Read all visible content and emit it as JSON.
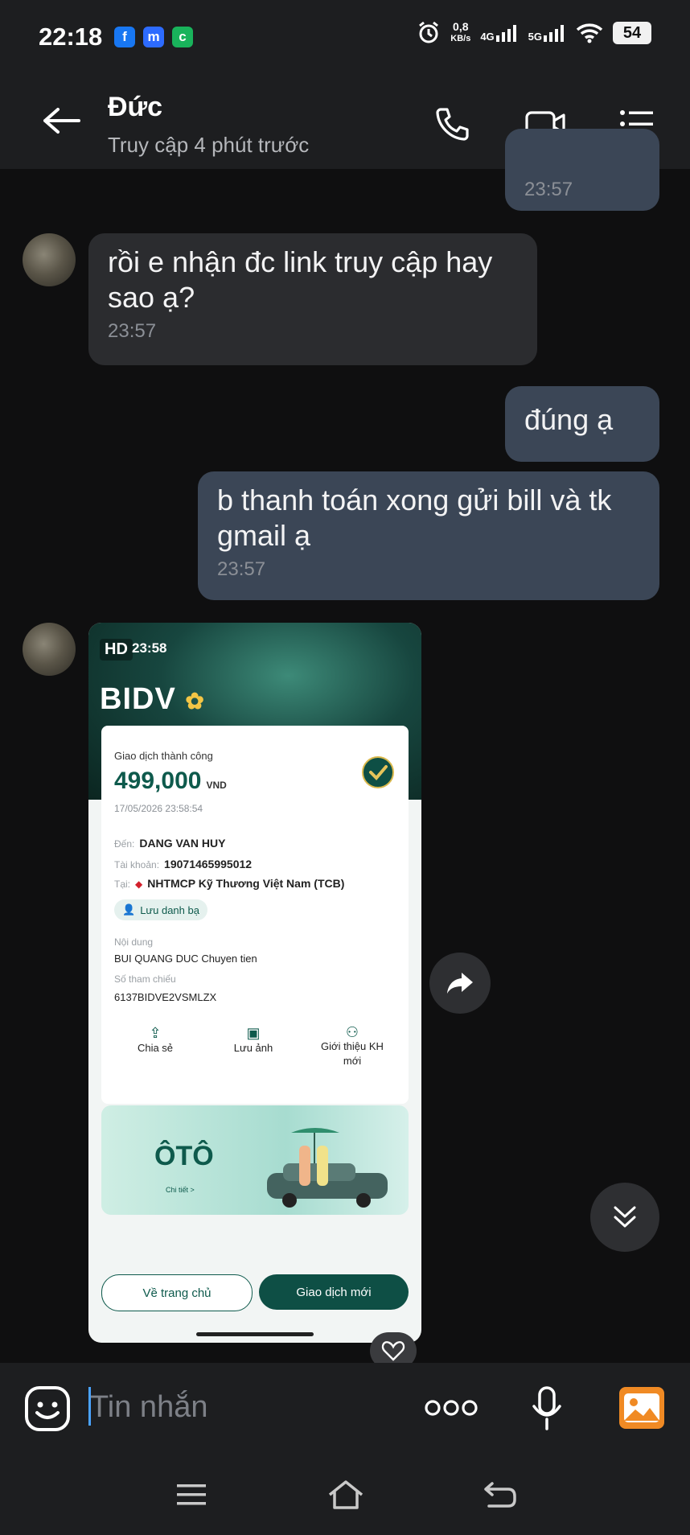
{
  "status_bar": {
    "time": "22:18",
    "apps": [
      "f",
      "m",
      "c"
    ],
    "speed_value": "0,8",
    "speed_unit": "KB/s",
    "net1": "4G",
    "net2": "5G",
    "battery": "54"
  },
  "header": {
    "name": "Đức",
    "subtitle": "Truy cập 4 phút trước"
  },
  "messages": {
    "m0_time": "23:57",
    "m1_text": "rồi e nhận đc link truy cập hay sao ạ?",
    "m1_time": "23:57",
    "m2_text": "đúng ạ",
    "m3_text": "b thanh toán xong gửi bill và tk gmail ạ",
    "m3_time": "23:57"
  },
  "receipt": {
    "hd_label": "HD",
    "status_time": "23:58",
    "bank_logo": "BIDV",
    "status_title": "Giao dịch thành công",
    "amount": "499,000",
    "currency": "VND",
    "datetime": "17/05/2026 23:58:54",
    "to_label": "Đến:",
    "to_value": "DANG VAN HUY",
    "account_label": "Tài khoản:",
    "account_value": "19071465995012",
    "at_label": "Tại:",
    "bank_value": "NHTMCP Kỹ Thương Việt Nam (TCB)",
    "save_contact": "Lưu danh bạ",
    "content_label": "Nội dung",
    "content_value": "BUI QUANG DUC Chuyen tien",
    "ref_label": "Số tham chiếu",
    "ref_value": "6137BIDVE2VSMLZX",
    "action_share": "Chia sẻ",
    "action_save": "Lưu ảnh",
    "action_refer": "Giới thiệu KH mới",
    "promo_title": "ÔTÔ",
    "promo_detail": "Chi tiết >",
    "btn_home": "Về trang chủ",
    "btn_new": "Giao dịch mới"
  },
  "composer": {
    "placeholder": "Tin nhắn"
  },
  "colors": {
    "outgoing_bubble": "#3b4656",
    "incoming_bubble": "#2b2c2f",
    "bank_green": "#0e5a4c"
  }
}
